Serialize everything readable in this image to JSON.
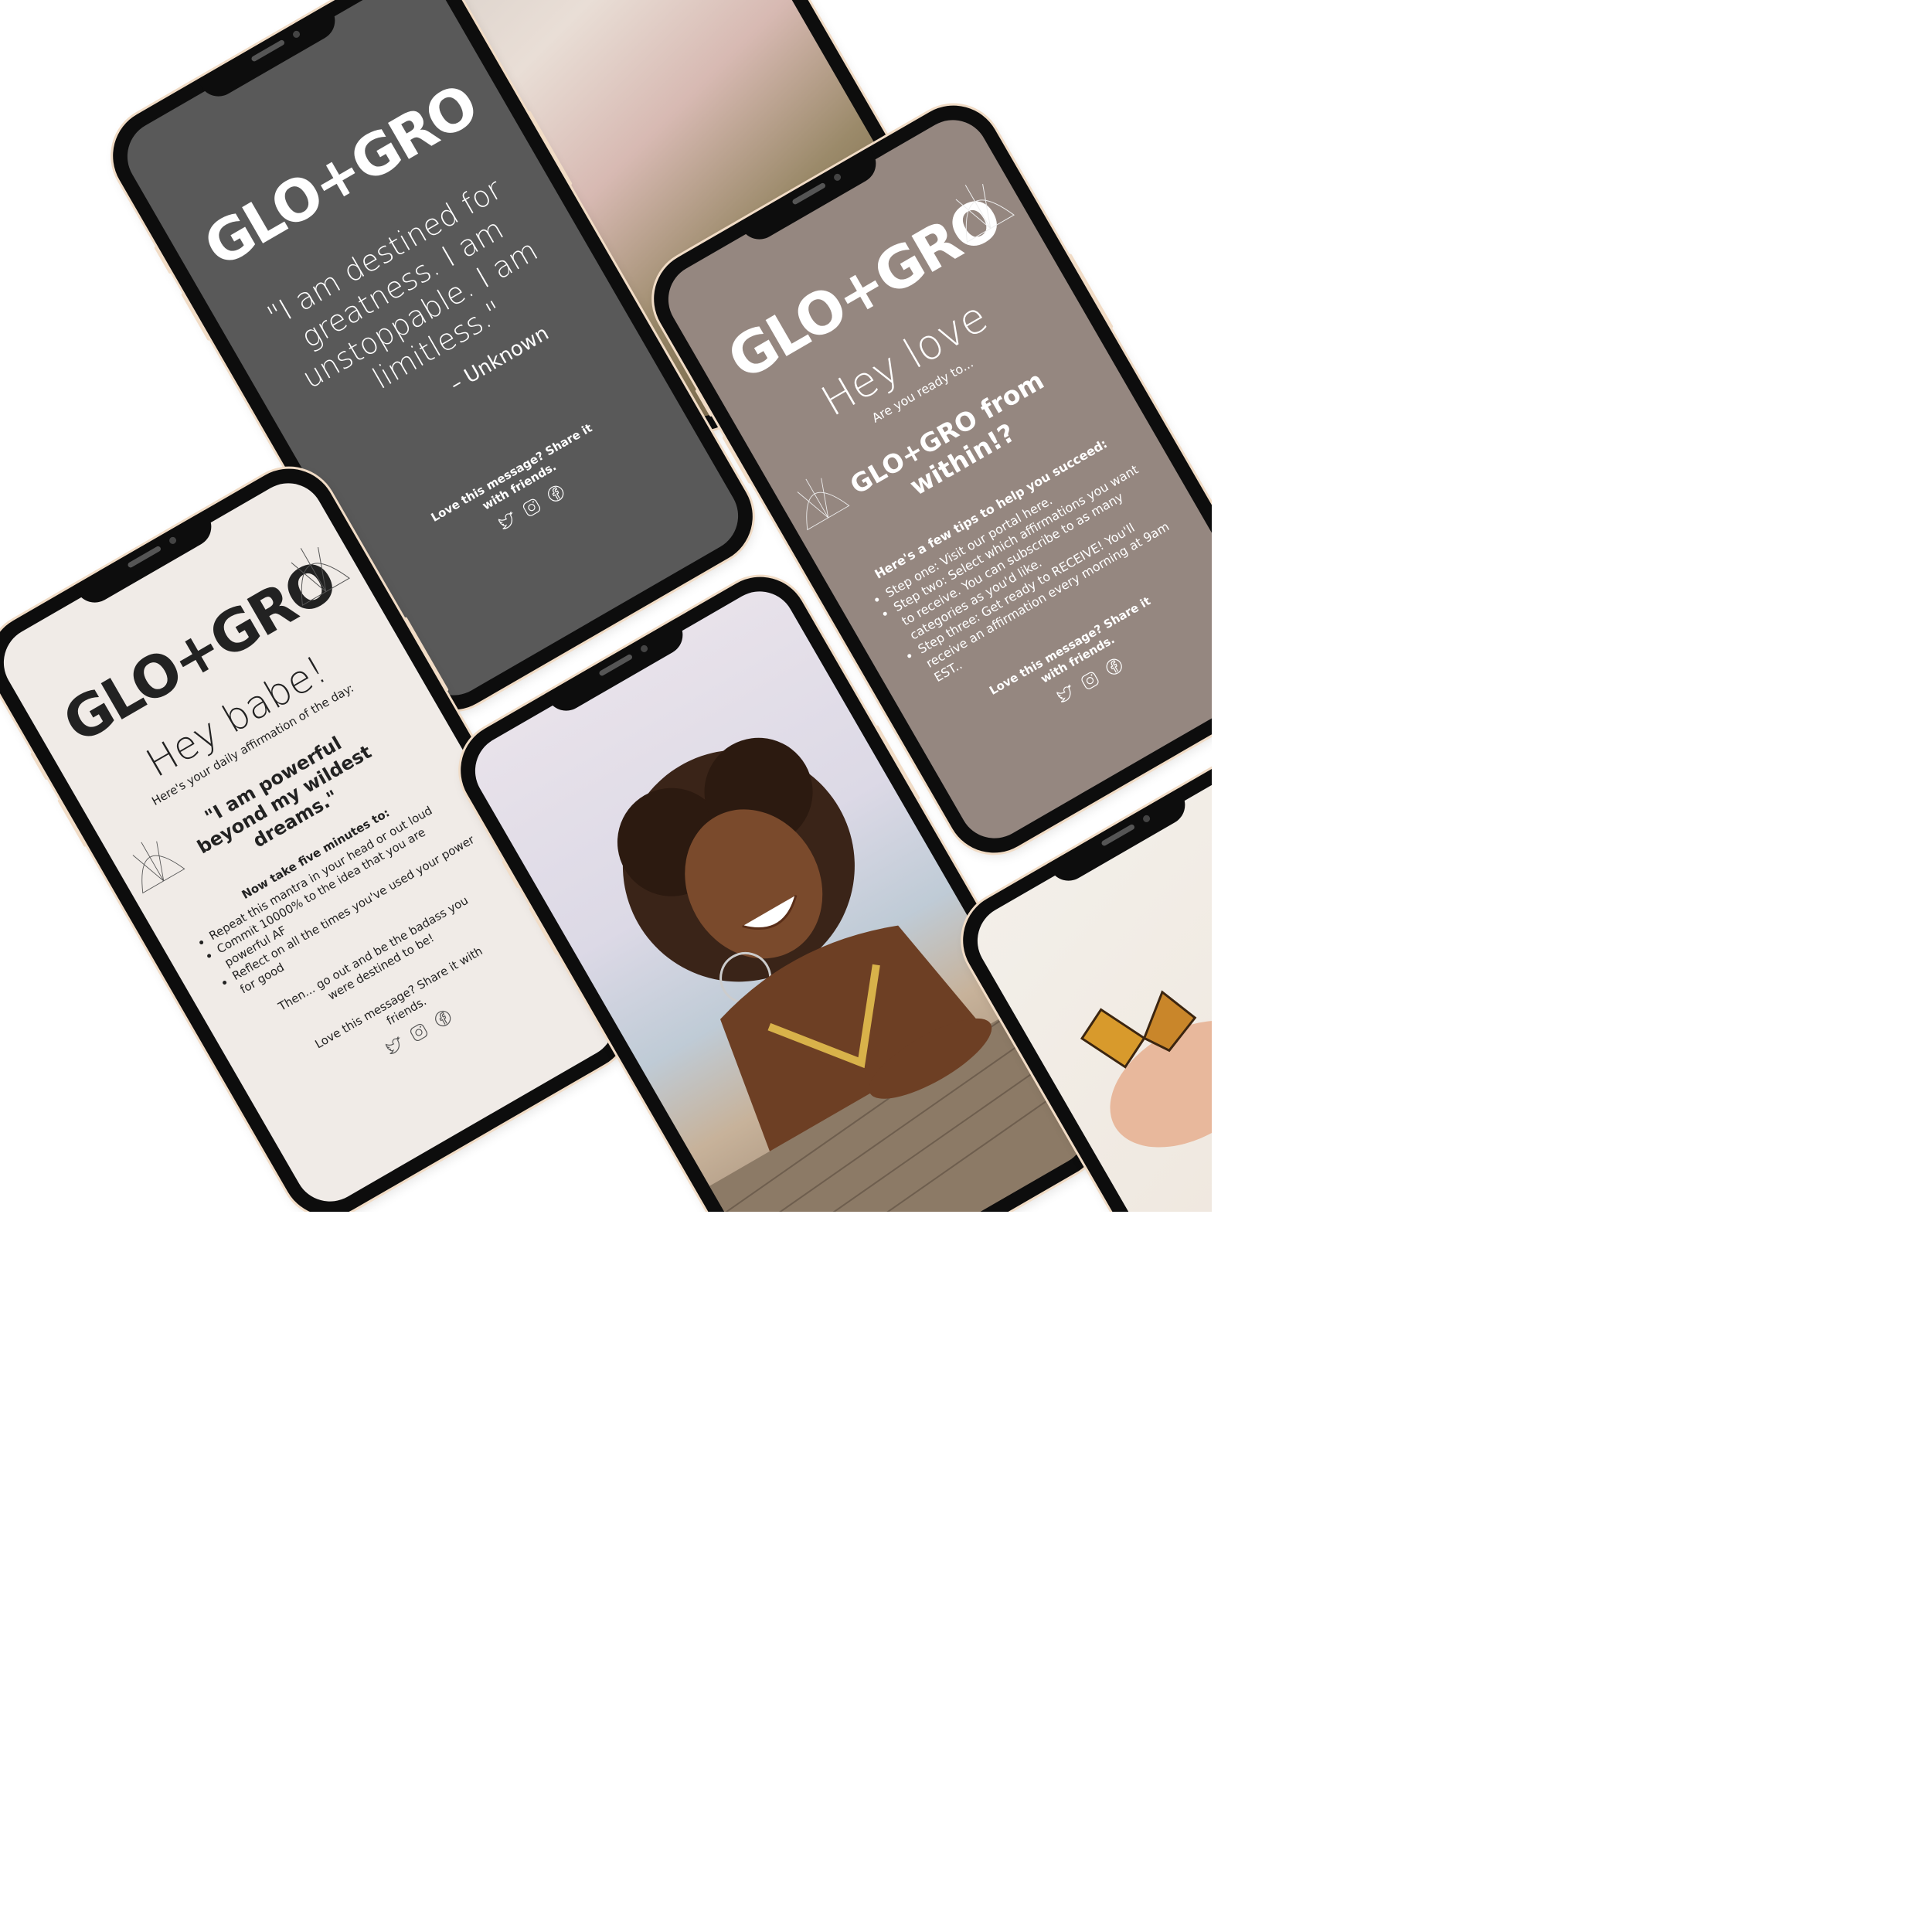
{
  "brand": {
    "logo": "GLO+GRO"
  },
  "phone_quote": {
    "quote": "\"I am destined for greatness. I am unstoppable. I am limitless.\"",
    "attribution": "– Unknown",
    "share": "Love this message? Share it with friends.",
    "bg": "#595959"
  },
  "phone_welcome": {
    "heading": "Hey love",
    "subheading": "Are you ready to...",
    "headline": "GLO+GRO from within!?",
    "tips_title": "Here's a few tips to help you succeed:",
    "tips": [
      "Step one: Visit our portal here.",
      "Step two: Select which affirmations you want to receive. You can subscribe to as many categories as you'd like.",
      "Step three: Get ready to RECEIVE! You'll receive an affirmation every morning at 9am EST.."
    ],
    "share": "Love this message? Share it with friends.",
    "bg": "#958780"
  },
  "phone_daily": {
    "heading": "Hey babe!",
    "subheading": "Here's your daily affirmation of the day:",
    "affirmation": "\"I am powerful beyond my wildest dreams.\"",
    "steps_title": "Now take five minutes to:",
    "steps": [
      "Repeat this mantra in your head or out loud",
      "Commit 10000% to the idea that you are powerful AF",
      "Reflect on all the times you've used your power for good"
    ],
    "closing": "Then... go out and be the badass you were destined to be!",
    "share": "Love this message? Share it with friends.",
    "bg": "#f0ebe7"
  },
  "social_icons": [
    "twitter-icon",
    "instagram-icon",
    "facebook-icon"
  ],
  "colors": {
    "frame": "#0d0d0d",
    "frame_edge": "#f1dcc6",
    "text_dark": "#222222",
    "text_light": "#ffffff"
  }
}
